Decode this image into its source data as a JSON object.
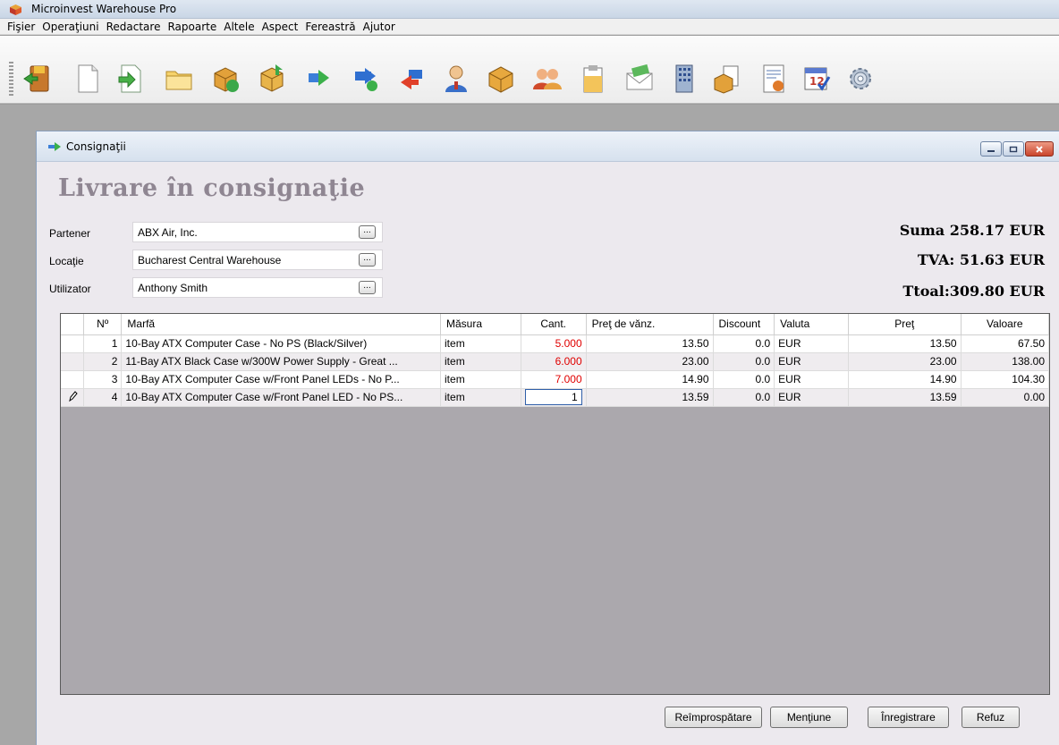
{
  "app": {
    "title": "Microinvest Warehouse Pro"
  },
  "menu": [
    "Fişier",
    "Operaţiuni",
    "Redactare",
    "Rapoarte",
    "Altele",
    "Aspect",
    "Fereastră",
    "Ajutor"
  ],
  "toolbar_icons": [
    "exit-icon",
    "new-document-icon",
    "import-icon",
    "open-folder-icon",
    "refresh-box-icon",
    "receive-box-icon",
    "transfer-right-icon",
    "transfer-check-icon",
    "transfer-left-icon",
    "user-icon",
    "box-icon",
    "partners-icon",
    "clipboard-icon",
    "money-envelope-icon",
    "building-icon",
    "documents-icon",
    "report-icon",
    "calendar-icon",
    "settings-gear-icon"
  ],
  "window": {
    "title": "Consignaţii",
    "heading": "Livrare în consignaţie",
    "fields": [
      {
        "label": "Partener",
        "value": "ABX Air, Inc."
      },
      {
        "label": "Locaţie",
        "value": "Bucharest Central Warehouse"
      },
      {
        "label": "Utilizator",
        "value": "Anthony Smith"
      }
    ],
    "ellipsis": "...",
    "totals": {
      "sum": "Suma 258.17 EUR",
      "vat": "TVA: 51.63 EUR",
      "total": "Ttoal:309.80 EUR"
    }
  },
  "grid": {
    "columns": [
      "Nº",
      "Marfă",
      "Măsura",
      "Cant.",
      "Preţ de vănz.",
      "Discount",
      "Valuta",
      "Preţ",
      "Valoare"
    ],
    "rows": [
      {
        "no": "1",
        "item": "10-Bay ATX Computer Case - No PS (Black/Silver)",
        "unit": "item",
        "qty": "5.000",
        "sale_price": "13.50",
        "discount": "0.0",
        "currency": "EUR",
        "price": "13.50",
        "value": "67.50"
      },
      {
        "no": "2",
        "item": "11-Bay ATX Black Case w/300W Power Supply - Great ...",
        "unit": "item",
        "qty": "6.000",
        "sale_price": "23.00",
        "discount": "0.0",
        "currency": "EUR",
        "price": "23.00",
        "value": "138.00"
      },
      {
        "no": "3",
        "item": "10-Bay ATX Computer Case w/Front Panel LEDs - No P...",
        "unit": "item",
        "qty": "7.000",
        "sale_price": "14.90",
        "discount": "0.0",
        "currency": "EUR",
        "price": "14.90",
        "value": "104.30"
      },
      {
        "no": "4",
        "item": "10-Bay ATX Computer Case w/Front Panel LED - No PS...",
        "unit": "item",
        "qty": "1",
        "sale_price": "13.59",
        "discount": "0.0",
        "currency": "EUR",
        "price": "13.59",
        "value": "0.00"
      }
    ]
  },
  "buttons": {
    "refresh": "Reîmprospătare",
    "note": "Menţiune",
    "save": "Înregistrare",
    "cancel": "Refuz"
  }
}
